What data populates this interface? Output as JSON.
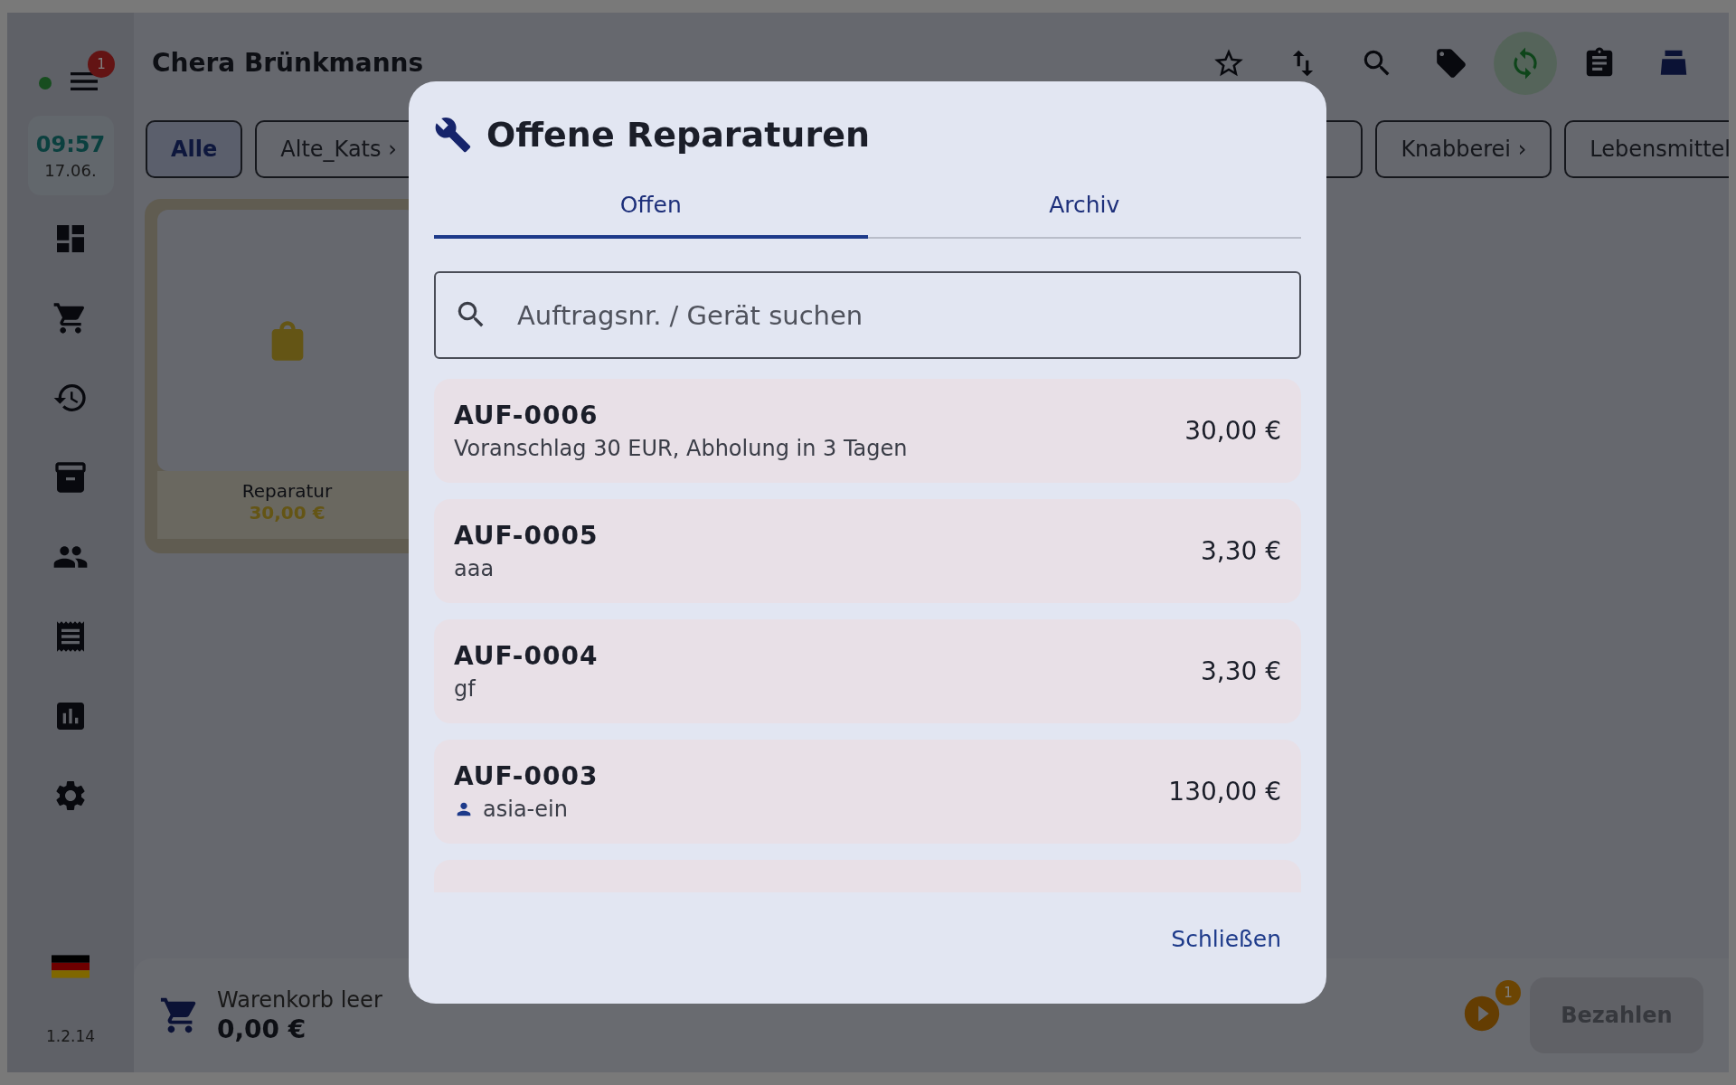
{
  "sidebar": {
    "online": true,
    "menu_badge": "1",
    "clock": {
      "time": "09:57",
      "date": "17.06."
    },
    "version": "1.2.14"
  },
  "header": {
    "title": "Chera Brünkmanns",
    "toolbar": [
      {
        "active": false
      },
      {
        "active": false
      },
      {
        "active": false
      },
      {
        "active": false
      },
      {
        "active": true
      },
      {
        "active": false
      },
      {
        "active": false
      }
    ]
  },
  "categories": [
    {
      "label": "Alle",
      "selected": true
    },
    {
      "label": "Alte_Kats ›",
      "selected": false
    },
    {
      "label": "Knabberei ›",
      "selected": false
    },
    {
      "label": "Lebensmittel",
      "selected": false
    }
  ],
  "products": [
    {
      "name": "Reparatur",
      "price": "30,00 €"
    }
  ],
  "cart": {
    "label": "Warenkorb leer",
    "total": "0,00 €",
    "queue_badge": "1",
    "pay_button": {
      "label": "Bezahlen",
      "disabled": true
    }
  },
  "dialog": {
    "title": "Offene Reparaturen",
    "tabs": [
      {
        "label": "Offen",
        "selected": true
      },
      {
        "label": "Archiv",
        "selected": false
      }
    ],
    "search": {
      "placeholder": "Auftragsnr. / Gerät suchen"
    },
    "orders": [
      {
        "number": "AUF-0006",
        "kind": "note",
        "detail": "Voranschlag 30 EUR, Abholung in 3 Tagen",
        "price": "30,00 €"
      },
      {
        "number": "AUF-0005",
        "kind": "note",
        "detail": "aaa",
        "price": "3,30 €"
      },
      {
        "number": "AUF-0004",
        "kind": "note",
        "detail": "gf",
        "price": "3,30 €"
      },
      {
        "number": "AUF-0003",
        "kind": "customer",
        "detail": "asia-ein",
        "price": "130,00 €"
      },
      {
        "kind": "partial"
      }
    ],
    "close_button": "Schließen"
  }
}
